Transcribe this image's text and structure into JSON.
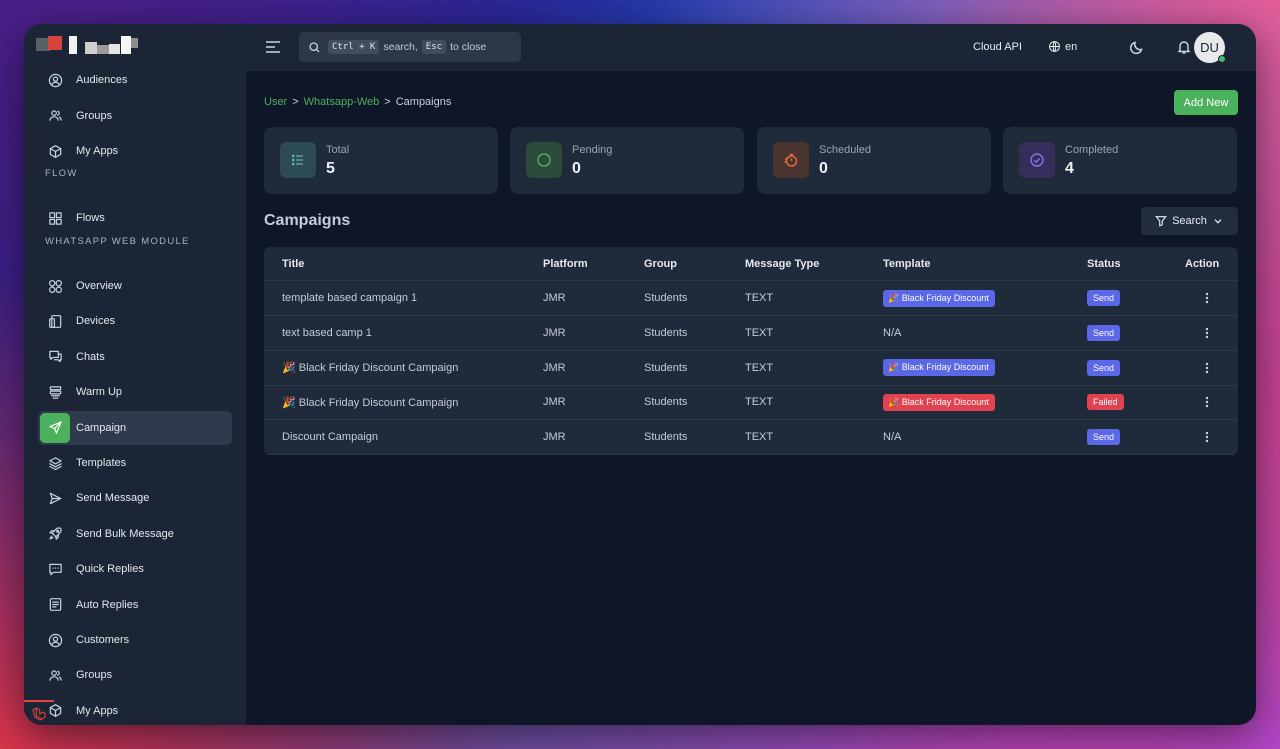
{
  "colors": {
    "accent_green": "#4bb15c",
    "badge_template_blue": "#5a67e6",
    "badge_template_red": "#e0424f",
    "badge_send": "#5a67e6",
    "badge_failed": "#e0424f"
  },
  "sidebar": {
    "items_top": [
      {
        "label": "Audiences",
        "icon": "user-circle-icon"
      },
      {
        "label": "Groups",
        "icon": "users-icon"
      },
      {
        "label": "My Apps",
        "icon": "cube-icon"
      }
    ],
    "section_flow": "FLOW",
    "items_flow": [
      {
        "label": "Flows",
        "icon": "grid-icon"
      }
    ],
    "section_wa": "WHATSAPP WEB MODULE",
    "items_wa": [
      {
        "label": "Overview",
        "icon": "circles-grid-icon"
      },
      {
        "label": "Devices",
        "icon": "devices-icon"
      },
      {
        "label": "Chats",
        "icon": "chat-icon"
      },
      {
        "label": "Warm Up",
        "icon": "stack-icon"
      },
      {
        "label": "Campaign",
        "icon": "send-icon",
        "active": true
      },
      {
        "label": "Templates",
        "icon": "layers-icon"
      },
      {
        "label": "Send Message",
        "icon": "play-send-icon"
      },
      {
        "label": "Send Bulk Message",
        "icon": "rocket-icon"
      },
      {
        "label": "Quick Replies",
        "icon": "message-square-icon"
      },
      {
        "label": "Auto Replies",
        "icon": "document-icon"
      },
      {
        "label": "Customers",
        "icon": "user-circle-icon"
      },
      {
        "label": "Groups",
        "icon": "users-icon"
      },
      {
        "label": "My Apps",
        "icon": "cube-icon"
      }
    ]
  },
  "header": {
    "search": {
      "kbd1": "Ctrl + K",
      "text1": "search,",
      "kbd2": "Esc",
      "text2": "to close"
    },
    "cloud_api": "Cloud API",
    "language": "en",
    "avatar_initials": "DU"
  },
  "breadcrumb": {
    "items": [
      "User",
      "Whatsapp-Web",
      "Campaigns"
    ],
    "sep": ">"
  },
  "add_new": "Add New",
  "stats": [
    {
      "label": "Total",
      "value": "5",
      "icon": "list-icon"
    },
    {
      "label": "Pending",
      "value": "0",
      "icon": "circle-icon"
    },
    {
      "label": "Scheduled",
      "value": "0",
      "icon": "stopwatch-icon"
    },
    {
      "label": "Completed",
      "value": "4",
      "icon": "check-circle-icon"
    }
  ],
  "section_title": "Campaigns",
  "search_button": "Search",
  "table": {
    "headers": [
      "Title",
      "Platform",
      "Group",
      "Message Type",
      "Template",
      "Status",
      "Action"
    ],
    "rows": [
      {
        "title": "template based campaign 1",
        "platform": "JMR",
        "group": "Students",
        "type": "TEXT",
        "template": "🎉 Black Friday Discount",
        "template_color": "blue",
        "status": "Send"
      },
      {
        "title": "text based camp 1",
        "platform": "JMR",
        "group": "Students",
        "type": "TEXT",
        "template": "N/A",
        "template_color": "none",
        "status": "Send"
      },
      {
        "title": "🎉 Black Friday Discount Campaign",
        "platform": "JMR",
        "group": "Students",
        "type": "TEXT",
        "template": "🎉 Black Friday Discount",
        "template_color": "blue",
        "status": "Send"
      },
      {
        "title": "🎉 Black Friday Discount Campaign",
        "platform": "JMR",
        "group": "Students",
        "type": "TEXT",
        "template": "🎉 Black Friday Discount",
        "template_color": "red",
        "status": "Failed"
      },
      {
        "title": "Discount Campaign",
        "platform": "JMR",
        "group": "Students",
        "type": "TEXT",
        "template": "N/A",
        "template_color": "none",
        "status": "Send"
      }
    ]
  }
}
